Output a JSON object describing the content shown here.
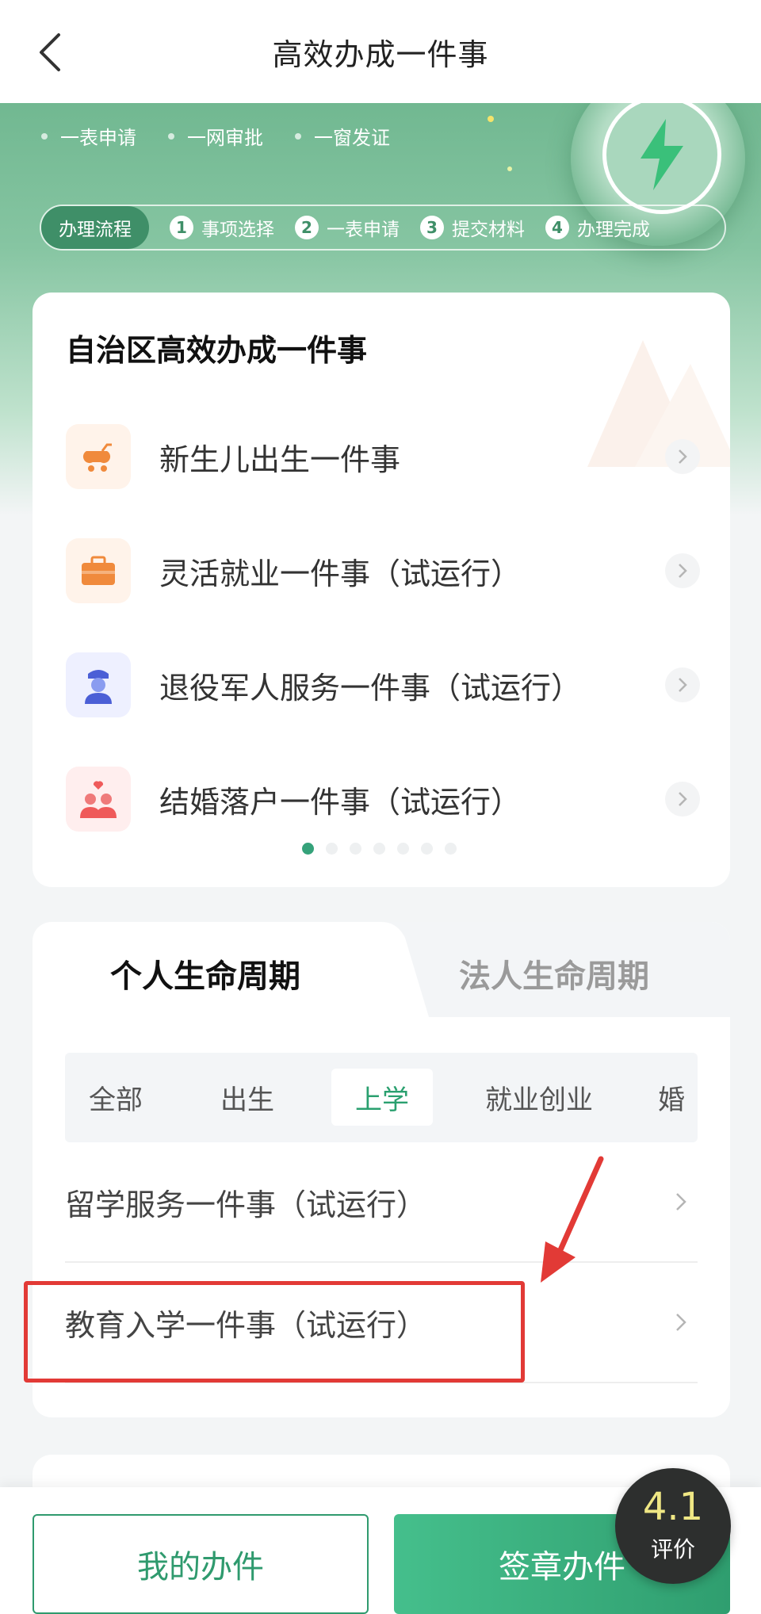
{
  "header": {
    "title": "高效办成一件事"
  },
  "hero": {
    "features": [
      "一表申请",
      "一网审批",
      "一窗发证"
    ],
    "flow_label": "办理流程",
    "steps": [
      {
        "num": "1",
        "label": "事项选择"
      },
      {
        "num": "2",
        "label": "一表申请"
      },
      {
        "num": "3",
        "label": "提交材料"
      },
      {
        "num": "4",
        "label": "办理完成"
      }
    ]
  },
  "regional_card": {
    "title": "自治区高效办成一件事",
    "items": [
      {
        "label": "新生儿出生一件事",
        "icon": "stroller-icon"
      },
      {
        "label": "灵活就业一件事（试运行）",
        "icon": "briefcase-icon"
      },
      {
        "label": "退役军人服务一件事（试运行）",
        "icon": "soldier-icon"
      },
      {
        "label": "结婚落户一件事（试运行）",
        "icon": "couple-icon"
      }
    ],
    "pagination": {
      "total": 7,
      "active": 1
    }
  },
  "lifecycle": {
    "tabs": [
      "个人生命周期",
      "法人生命周期"
    ],
    "active_tab": "个人生命周期",
    "categories": [
      "全部",
      "出生",
      "上学",
      "就业创业",
      "婚"
    ],
    "active_category": "上学",
    "rows": [
      "留学服务一件事（试运行）",
      "教育入学一件事（试运行）"
    ]
  },
  "bottom": {
    "my_button": "我的办件",
    "sign_button": "签章办件",
    "rating_score": "4.1",
    "rating_label": "评价"
  },
  "colors": {
    "accent": "#2f9a6e",
    "highlight": "#e23a36",
    "hero_green": "#71b891"
  }
}
